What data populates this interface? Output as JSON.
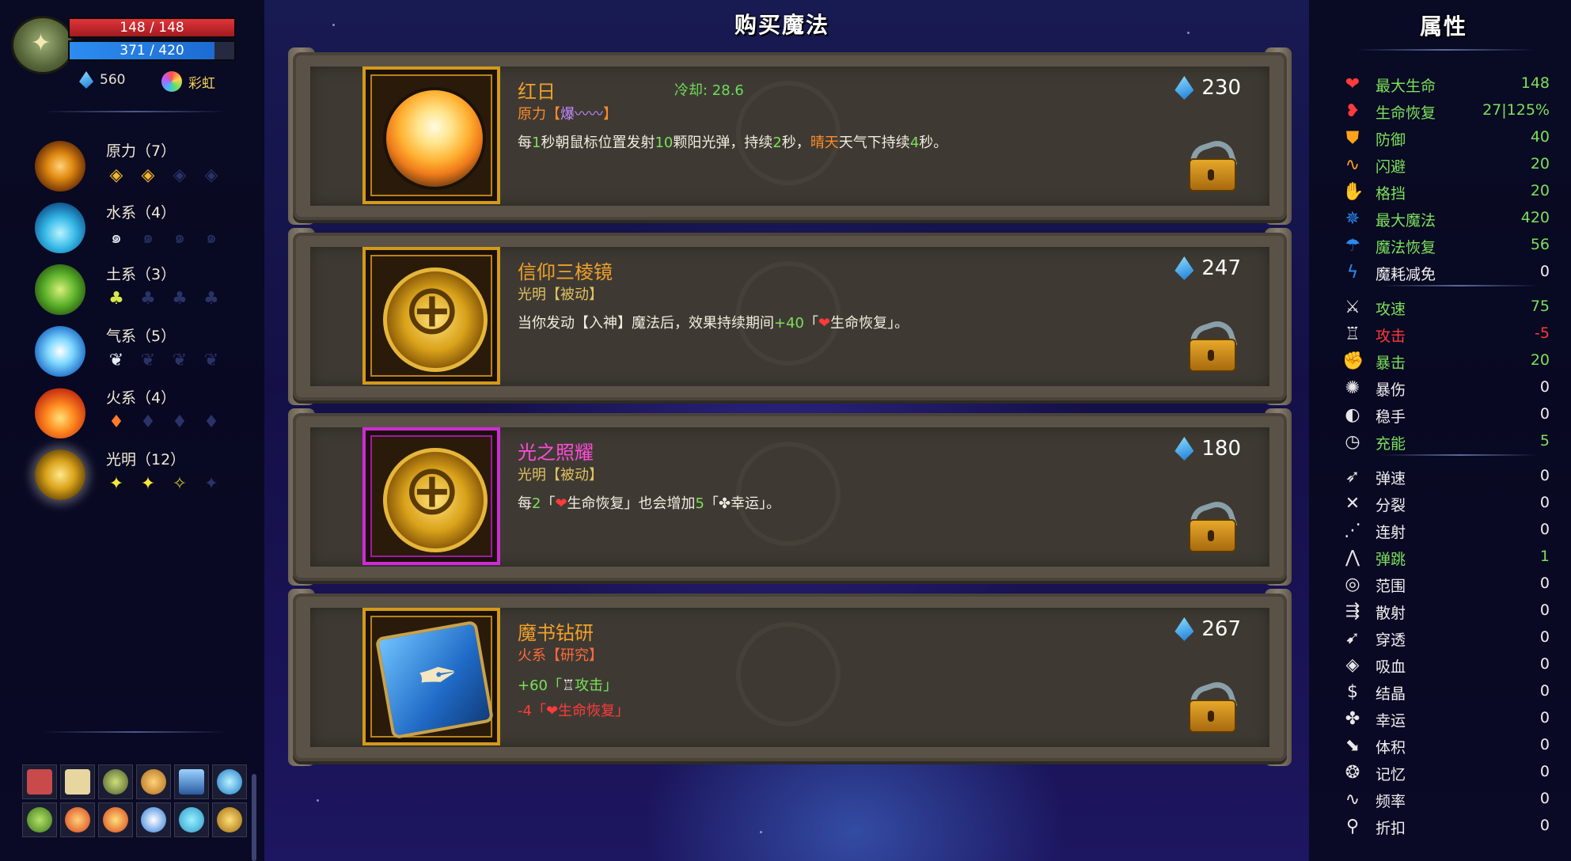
{
  "player": {
    "hp": "148 / 148",
    "mp": "371 / 420",
    "crystals": "560",
    "rainbow_label": "彩虹"
  },
  "schools": [
    {
      "name": "原力（7）"
    },
    {
      "name": "水系（4）"
    },
    {
      "name": "土系（3）"
    },
    {
      "name": "气系（5）"
    },
    {
      "name": "火系（4）"
    },
    {
      "name": "光明（12）"
    }
  ],
  "shop": {
    "title": "购买魔法",
    "items": [
      {
        "name": "红日",
        "cooldown": "冷却: 28.6",
        "tag": "原力【",
        "tag_extra": "爆〰〰",
        "tag_end": "】",
        "desc": [
          "每",
          "1",
          "秒朝鼠标位置发射",
          "10",
          "颗阳光弹，持续",
          "2",
          "秒，",
          "晴天",
          "天气下持续",
          "4",
          "秒。"
        ],
        "price": "230"
      },
      {
        "name": "信仰三棱镜",
        "tag": "光明【被动】",
        "desc": [
          "当你发动【入神】魔法后，效果持续期间",
          "+40",
          "「",
          "❤",
          "生命恢复」。"
        ],
        "price": "247"
      },
      {
        "name": "光之照耀",
        "tag": "光明【被动】",
        "desc": [
          "每",
          "2",
          "「",
          "❤",
          "生命恢复」也会增加",
          "5",
          "「",
          "✤",
          "幸运」。"
        ],
        "price": "180"
      },
      {
        "name": "魔书钻研",
        "tag": "火系【研究】",
        "line1": [
          "+60「",
          "♖",
          "攻击」"
        ],
        "line2": [
          "-4「",
          "❤",
          "生命恢复」"
        ],
        "price": "267"
      }
    ]
  },
  "attributes": {
    "title": "属性",
    "stats": [
      {
        "label": "最大生命",
        "value": "148",
        "icon": "heart-icon",
        "color": "#7be05a"
      },
      {
        "label": "生命恢复",
        "value": "27|125%",
        "icon": "hearts-regen-icon",
        "color": "#7be05a"
      },
      {
        "label": "防御",
        "value": "40",
        "icon": "shield-icon",
        "color": "#7be05a"
      },
      {
        "label": "闪避",
        "value": "20",
        "icon": "dodge-icon",
        "color": "#7be05a"
      },
      {
        "label": "格挡",
        "value": "20",
        "icon": "block-icon",
        "color": "#7be05a"
      },
      {
        "label": "最大魔法",
        "value": "420",
        "icon": "mana-icon",
        "color": "#7be05a"
      },
      {
        "label": "魔法恢复",
        "value": "56",
        "icon": "mana-regen-icon",
        "color": "#7be05a"
      },
      {
        "label": "魔耗减免",
        "value": "0",
        "icon": "mana-cost-icon",
        "color": "#ffffff"
      },
      {
        "label": "攻速",
        "value": "75",
        "icon": "attack-speed-icon",
        "color": "#7be05a"
      },
      {
        "label": "攻击",
        "value": "-5",
        "icon": "attack-icon",
        "color": "#ff3a3a"
      },
      {
        "label": "暴击",
        "value": "20",
        "icon": "crit-icon",
        "color": "#7be05a"
      },
      {
        "label": "暴伤",
        "value": "0",
        "icon": "crit-damage-icon",
        "color": "#ffffff"
      },
      {
        "label": "稳手",
        "value": "0",
        "icon": "steady-icon",
        "color": "#ffffff"
      },
      {
        "label": "充能",
        "value": "5",
        "icon": "charge-icon",
        "color": "#7be05a"
      },
      {
        "label": "弹速",
        "value": "0",
        "icon": "bullet-speed-icon",
        "color": "#ffffff"
      },
      {
        "label": "分裂",
        "value": "0",
        "icon": "split-icon",
        "color": "#ffffff"
      },
      {
        "label": "连射",
        "value": "0",
        "icon": "multishot-icon",
        "color": "#ffffff"
      },
      {
        "label": "弹跳",
        "value": "1",
        "icon": "bounce-icon",
        "color": "#7be05a"
      },
      {
        "label": "范围",
        "value": "0",
        "icon": "range-icon",
        "color": "#ffffff"
      },
      {
        "label": "散射",
        "value": "0",
        "icon": "scatter-icon",
        "color": "#ffffff"
      },
      {
        "label": "穿透",
        "value": "0",
        "icon": "pierce-icon",
        "color": "#ffffff"
      },
      {
        "label": "吸血",
        "value": "0",
        "icon": "lifesteal-icon",
        "color": "#ffffff"
      },
      {
        "label": "结晶",
        "value": "0",
        "icon": "crystal-icon",
        "color": "#ffffff"
      },
      {
        "label": "幸运",
        "value": "0",
        "icon": "luck-icon",
        "color": "#ffffff"
      },
      {
        "label": "体积",
        "value": "0",
        "icon": "size-icon",
        "color": "#ffffff"
      },
      {
        "label": "记忆",
        "value": "0",
        "icon": "memory-icon",
        "color": "#ffffff"
      },
      {
        "label": "频率",
        "value": "0",
        "icon": "frequency-icon",
        "color": "#ffffff"
      },
      {
        "label": "折扣",
        "value": "0",
        "icon": "discount-icon",
        "color": "#ffffff"
      }
    ]
  }
}
